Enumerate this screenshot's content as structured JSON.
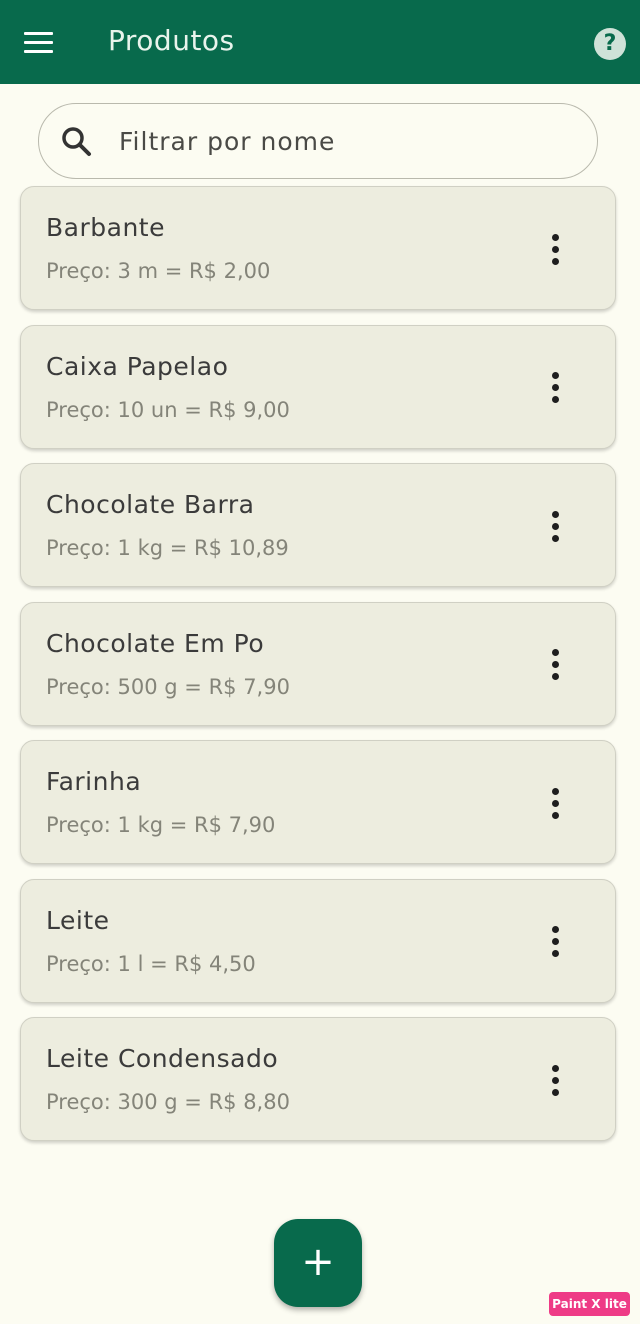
{
  "appbar": {
    "title": "Produtos",
    "menu_icon": "hamburger-menu-icon",
    "help_icon": "help-circle-icon",
    "help_glyph": "?"
  },
  "search": {
    "placeholder": "Filtrar por nome",
    "value": "",
    "icon": "search-icon"
  },
  "products": [
    {
      "name": "Barbante",
      "price": "Preço: 3 m = R$ 2,00"
    },
    {
      "name": "Caixa Papelao",
      "price": "Preço: 10 un = R$ 9,00"
    },
    {
      "name": "Chocolate Barra",
      "price": "Preço: 1 kg = R$ 10,89"
    },
    {
      "name": "Chocolate Em Po",
      "price": "Preço: 500 g = R$ 7,90"
    },
    {
      "name": "Farinha",
      "price": "Preço: 1 kg = R$ 7,90"
    },
    {
      "name": "Leite",
      "price": "Preço: 1 l = R$ 4,50"
    },
    {
      "name": "Leite Condensado",
      "price": "Preço: 300 g = R$ 8,80"
    }
  ],
  "fab": {
    "label": "+",
    "icon": "add-icon"
  },
  "watermark": "Paint X lite",
  "colors": {
    "primary": "#086a4c",
    "background": "#fcfcf2",
    "card": "#ededdf",
    "watermark": "#ee3b86"
  }
}
